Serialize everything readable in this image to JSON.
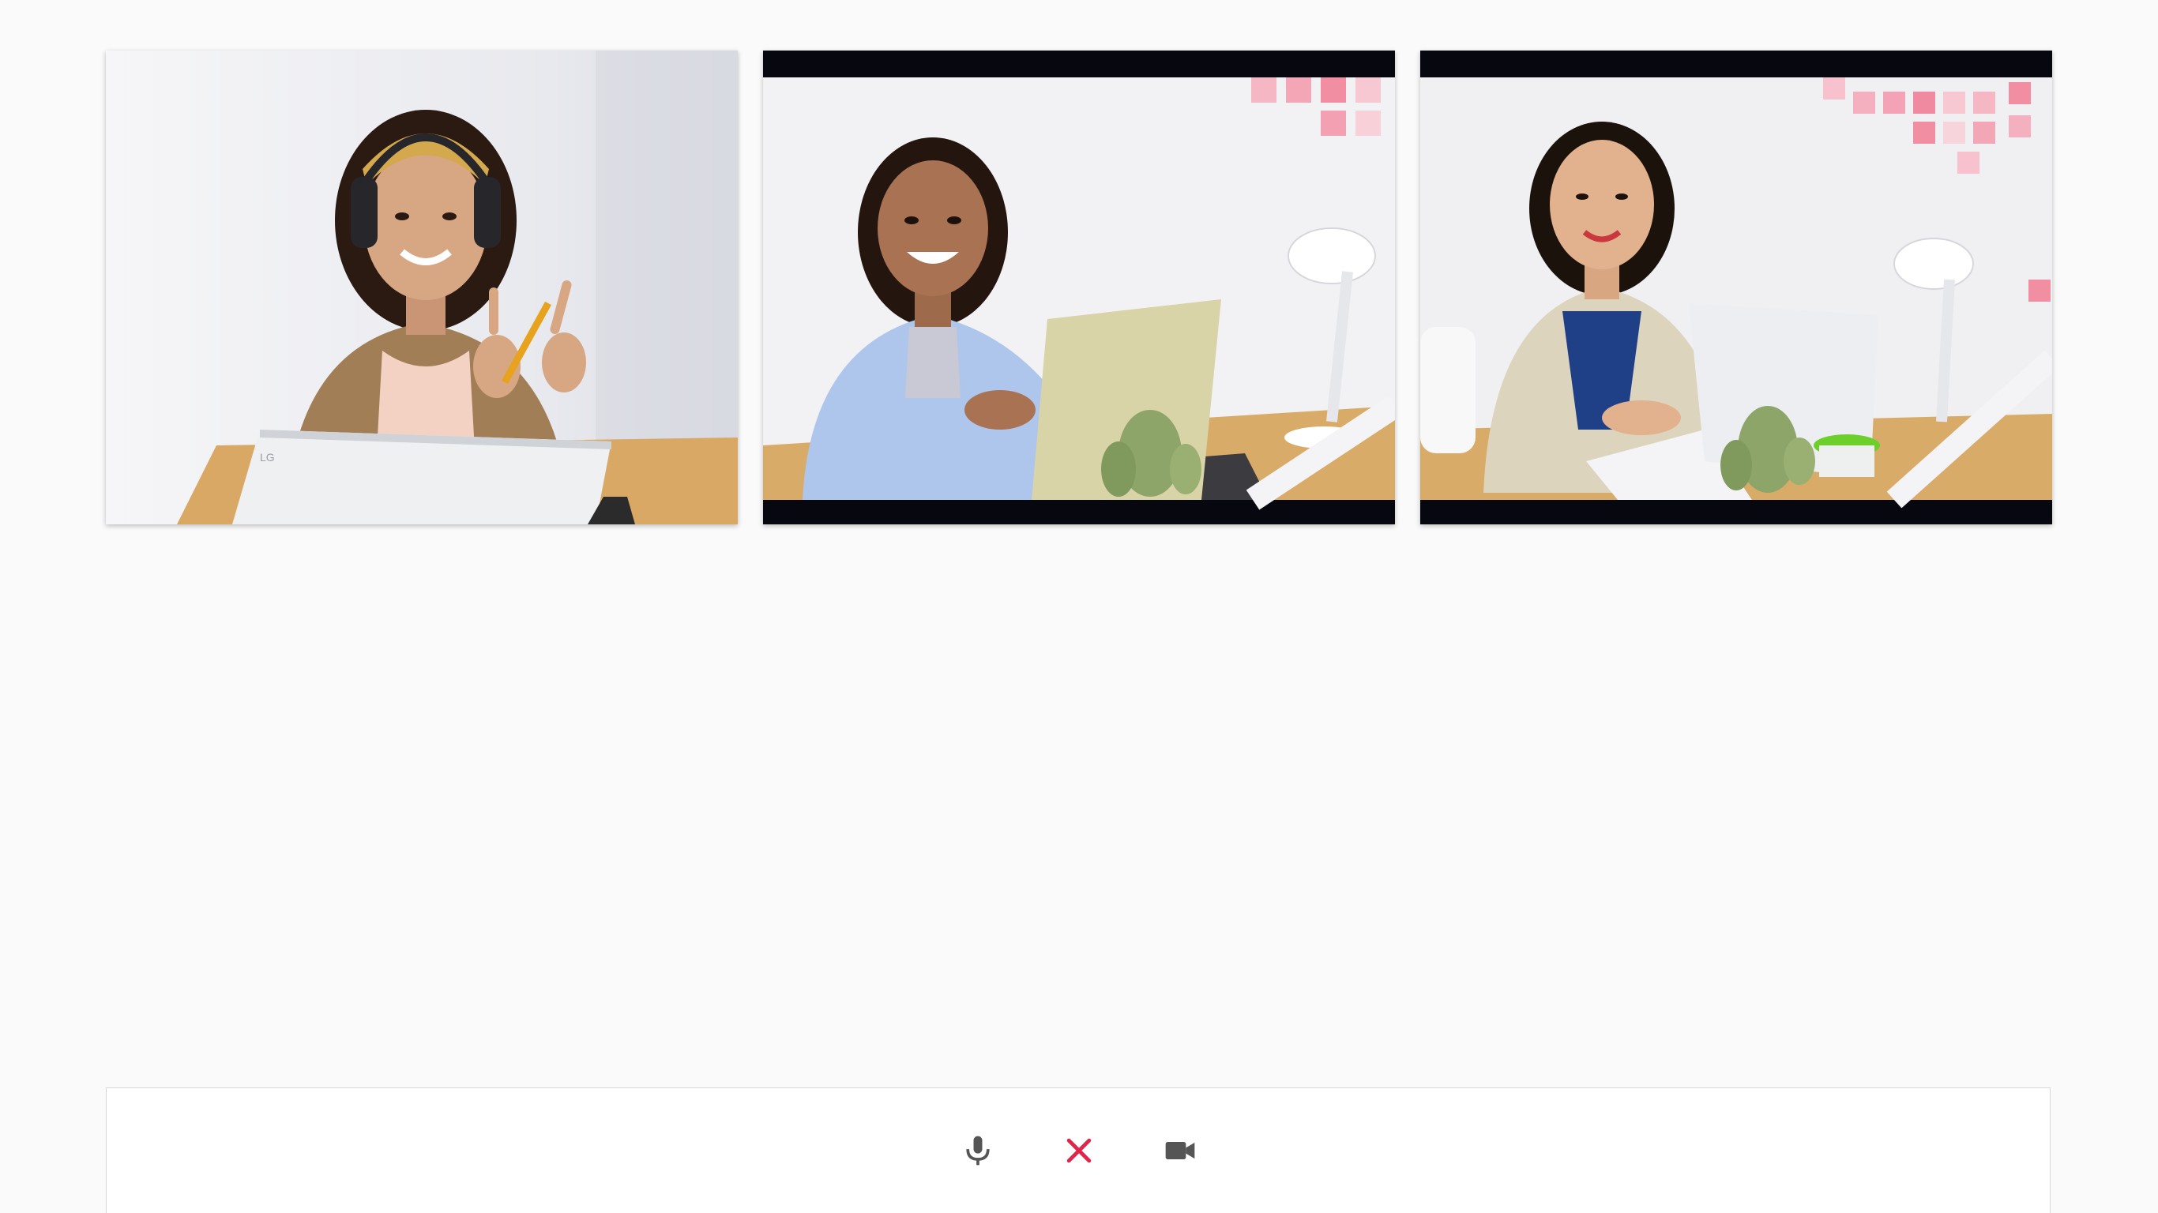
{
  "participants": [
    {
      "id": "participant-1",
      "video": "live"
    },
    {
      "id": "participant-2",
      "video": "live"
    },
    {
      "id": "participant-3",
      "video": "live"
    }
  ],
  "controls": {
    "mic": {
      "icon": "microphone-icon"
    },
    "end": {
      "icon": "close-icon",
      "color": "#e0244a"
    },
    "camera": {
      "icon": "video-camera-icon"
    }
  },
  "colors": {
    "background": "#fafafa",
    "icon": "#555555",
    "end_call": "#e0244a"
  }
}
